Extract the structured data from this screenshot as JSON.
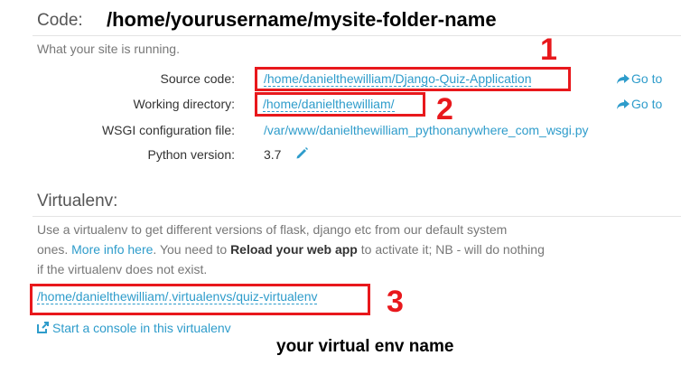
{
  "code_section": {
    "heading": "Code:",
    "path_annotation": "/home/yourusername/mysite-folder-name",
    "description": "What your site is running.",
    "rows": {
      "source_code": {
        "label": "Source code:",
        "value": "/home/danielthewilliam/Django-Quiz-Application",
        "goto": "Go to"
      },
      "working_dir": {
        "label": "Working directory:",
        "value": "/home/danielthewilliam/",
        "goto": "Go to"
      },
      "wsgi": {
        "label": "WSGI configuration file:",
        "value": "/var/www/danielthewilliam_pythonanywhere_com_wsgi.py"
      },
      "python": {
        "label": "Python version:",
        "value": "3.7"
      }
    },
    "markers": {
      "one": "1",
      "two": "2"
    }
  },
  "virtualenv_section": {
    "heading": "Virtualenv:",
    "text_1": "Use a virtualenv to get different versions of flask, django etc from our default system",
    "text_2a": "ones. ",
    "more_info": "More info here",
    "text_2b": ". You need to ",
    "reload": "Reload your web app",
    "text_2c": " to activate it; NB - will do nothing",
    "text_3": "if the virtualenv does not exist.",
    "path": "/home/danielthewilliam/.virtualenvs/quiz-virtualenv",
    "console_link": "Start a console in this virtualenv",
    "marker_three": "3",
    "env_annotation": "your virtual env name"
  },
  "colors": {
    "link": "#2e9ccb",
    "annotation_red": "#e8181c",
    "annotation_black": "#000000"
  },
  "icons": [
    "arrow-share-icon",
    "pencil-icon",
    "external-console-icon"
  ]
}
